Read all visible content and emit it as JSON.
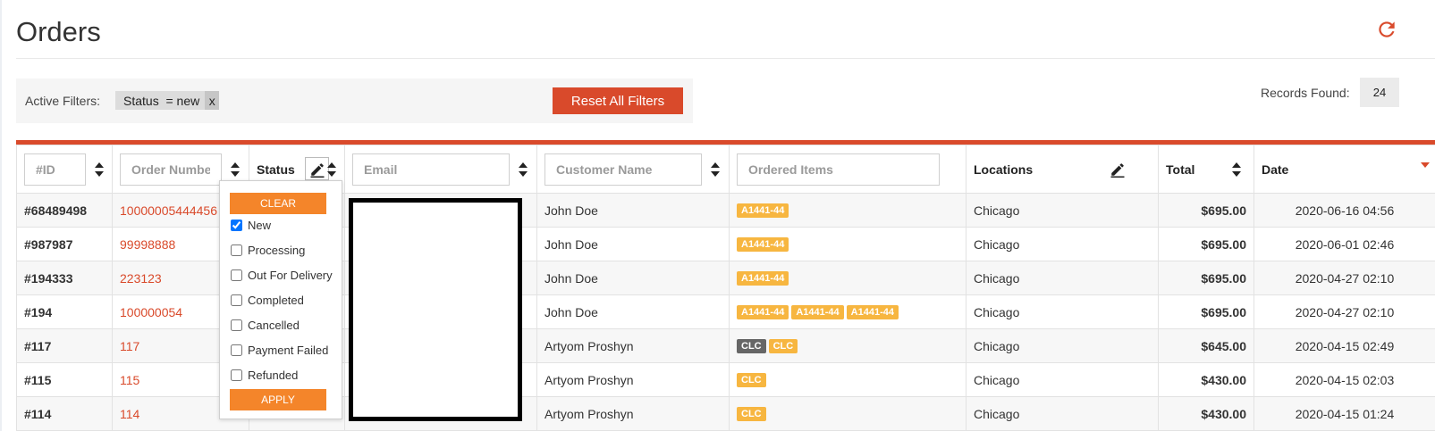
{
  "header": {
    "title": "Orders",
    "refresh_icon": "refresh-icon"
  },
  "filters": {
    "label": "Active Filters:",
    "chips": [
      {
        "text": "Status  = new",
        "remove": "x"
      }
    ],
    "reset_label": "Reset All Filters"
  },
  "records": {
    "label": "Records Found:",
    "count": "24"
  },
  "colors": {
    "accent": "#d94a2b",
    "tag": "#f7b640",
    "tag_dark": "#666666",
    "popup_button": "#f4852a"
  },
  "table": {
    "headers": {
      "id_placeholder": "#ID",
      "order_placeholder": "Order Number",
      "status": "Status",
      "email_placeholder": "Email",
      "customer_placeholder": "Customer Name",
      "items_placeholder": "Ordered Items",
      "locations": "Locations",
      "total": "Total",
      "date": "Date"
    },
    "rows": [
      {
        "id": "#68489498",
        "order": "10000005444456",
        "customer": "John Doe",
        "items": [
          {
            "t": "A1441-44",
            "dark": false
          }
        ],
        "location": "Chicago",
        "total": "$695.00",
        "date": "2020-06-16 04:56"
      },
      {
        "id": "#987987",
        "order": "99998888",
        "customer": "John Doe",
        "items": [
          {
            "t": "A1441-44",
            "dark": false
          }
        ],
        "location": "Chicago",
        "total": "$695.00",
        "date": "2020-06-01 02:46"
      },
      {
        "id": "#194333",
        "order": "223123",
        "customer": "John Doe",
        "items": [
          {
            "t": "A1441-44",
            "dark": false
          }
        ],
        "location": "Chicago",
        "total": "$695.00",
        "date": "2020-04-27 02:10"
      },
      {
        "id": "#194",
        "order": "100000054",
        "customer": "John Doe",
        "items": [
          {
            "t": "A1441-44",
            "dark": false
          },
          {
            "t": "A1441-44",
            "dark": false
          },
          {
            "t": "A1441-44",
            "dark": false
          }
        ],
        "location": "Chicago",
        "total": "$695.00",
        "date": "2020-04-27 02:10"
      },
      {
        "id": "#117",
        "order": "117",
        "customer": "Artyom Proshyn",
        "items": [
          {
            "t": "CLC",
            "dark": true
          },
          {
            "t": "CLC",
            "dark": false
          }
        ],
        "location": "Chicago",
        "total": "$645.00",
        "date": "2020-04-15 02:49"
      },
      {
        "id": "#115",
        "order": "115",
        "customer": "Artyom Proshyn",
        "items": [
          {
            "t": "CLC",
            "dark": false
          }
        ],
        "location": "Chicago",
        "total": "$430.00",
        "date": "2020-04-15 02:03"
      },
      {
        "id": "#114",
        "order": "114",
        "customer": "Artyom Proshyn",
        "items": [
          {
            "t": "CLC",
            "dark": false
          }
        ],
        "location": "Chicago",
        "total": "$430.00",
        "date": "2020-04-15 01:24"
      }
    ]
  },
  "status_popup": {
    "clear_label": "CLEAR",
    "apply_label": "APPLY",
    "options": [
      {
        "label": "New",
        "checked": true
      },
      {
        "label": "Processing",
        "checked": false
      },
      {
        "label": "Out For Delivery",
        "checked": false
      },
      {
        "label": "Completed",
        "checked": false
      },
      {
        "label": "Cancelled",
        "checked": false
      },
      {
        "label": "Payment Failed",
        "checked": false
      },
      {
        "label": "Refunded",
        "checked": false
      }
    ]
  }
}
